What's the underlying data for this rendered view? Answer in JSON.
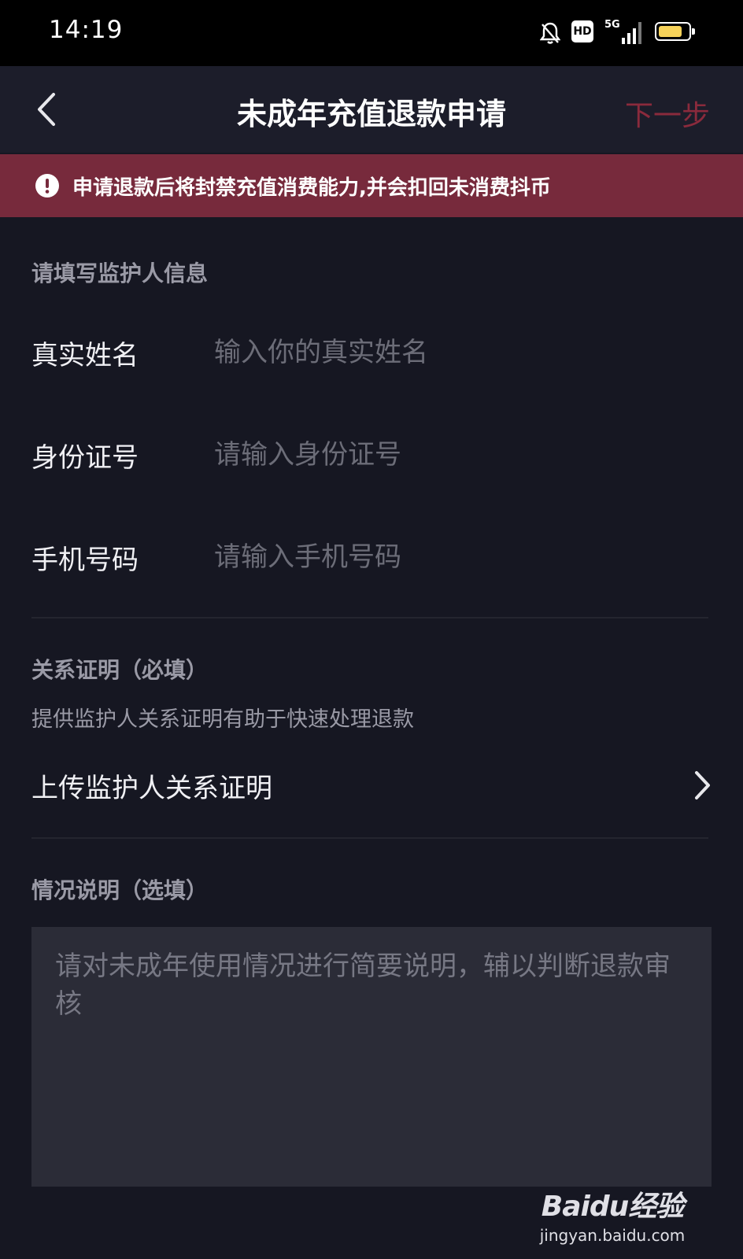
{
  "status_bar": {
    "time": "14:19",
    "hd_label": "HD",
    "network_label": "5G",
    "icons": [
      "bell-muted-icon",
      "hd-icon",
      "signal-5g-icon",
      "battery-icon"
    ],
    "battery_level": 0.8
  },
  "header": {
    "title": "未成年充值退款申请",
    "next_label": "下一步",
    "back_icon": "chevron-left-icon"
  },
  "warning": {
    "icon": "exclamation-circle-icon",
    "text": "申请退款后将封禁充值消费能力,并会扣回未消费抖币"
  },
  "guardian_section": {
    "title": "请填写监护人信息",
    "fields": [
      {
        "label": "真实姓名",
        "placeholder": "输入你的真实姓名"
      },
      {
        "label": "身份证号",
        "placeholder": "请输入身份证号"
      },
      {
        "label": "手机号码",
        "placeholder": "请输入手机号码"
      }
    ]
  },
  "relation_section": {
    "title": "关系证明（必填）",
    "hint": "提供监护人关系证明有助于快速处理退款",
    "upload_label": "上传监护人关系证明",
    "upload_icon": "chevron-right-icon"
  },
  "description_section": {
    "title": "情况说明（选填）",
    "placeholder": "请对未成年使用情况进行简要说明，辅以判断退款审核"
  },
  "watermark": {
    "logo": "Baidu经验",
    "url": "jingyan.baidu.com"
  },
  "colors": {
    "background": "#161722",
    "warning_bg": "#772a3c",
    "next_disabled": "#8a2a3c",
    "battery_fill": "#f7d35a"
  }
}
